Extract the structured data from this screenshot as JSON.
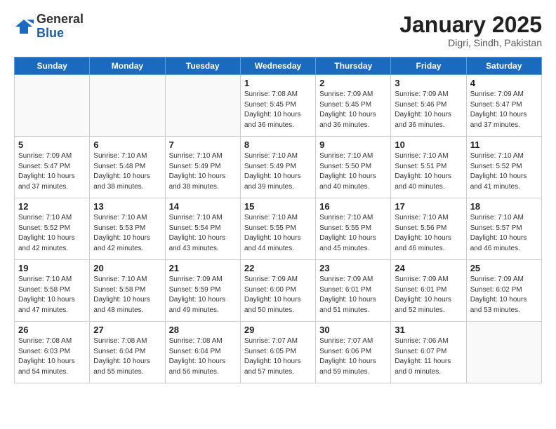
{
  "header": {
    "logo_general": "General",
    "logo_blue": "Blue",
    "title": "January 2025",
    "subtitle": "Digri, Sindh, Pakistan"
  },
  "days_of_week": [
    "Sunday",
    "Monday",
    "Tuesday",
    "Wednesday",
    "Thursday",
    "Friday",
    "Saturday"
  ],
  "weeks": [
    [
      {
        "num": "",
        "info": ""
      },
      {
        "num": "",
        "info": ""
      },
      {
        "num": "",
        "info": ""
      },
      {
        "num": "1",
        "info": "Sunrise: 7:08 AM\nSunset: 5:45 PM\nDaylight: 10 hours\nand 36 minutes."
      },
      {
        "num": "2",
        "info": "Sunrise: 7:09 AM\nSunset: 5:45 PM\nDaylight: 10 hours\nand 36 minutes."
      },
      {
        "num": "3",
        "info": "Sunrise: 7:09 AM\nSunset: 5:46 PM\nDaylight: 10 hours\nand 36 minutes."
      },
      {
        "num": "4",
        "info": "Sunrise: 7:09 AM\nSunset: 5:47 PM\nDaylight: 10 hours\nand 37 minutes."
      }
    ],
    [
      {
        "num": "5",
        "info": "Sunrise: 7:09 AM\nSunset: 5:47 PM\nDaylight: 10 hours\nand 37 minutes."
      },
      {
        "num": "6",
        "info": "Sunrise: 7:10 AM\nSunset: 5:48 PM\nDaylight: 10 hours\nand 38 minutes."
      },
      {
        "num": "7",
        "info": "Sunrise: 7:10 AM\nSunset: 5:49 PM\nDaylight: 10 hours\nand 38 minutes."
      },
      {
        "num": "8",
        "info": "Sunrise: 7:10 AM\nSunset: 5:49 PM\nDaylight: 10 hours\nand 39 minutes."
      },
      {
        "num": "9",
        "info": "Sunrise: 7:10 AM\nSunset: 5:50 PM\nDaylight: 10 hours\nand 40 minutes."
      },
      {
        "num": "10",
        "info": "Sunrise: 7:10 AM\nSunset: 5:51 PM\nDaylight: 10 hours\nand 40 minutes."
      },
      {
        "num": "11",
        "info": "Sunrise: 7:10 AM\nSunset: 5:52 PM\nDaylight: 10 hours\nand 41 minutes."
      }
    ],
    [
      {
        "num": "12",
        "info": "Sunrise: 7:10 AM\nSunset: 5:52 PM\nDaylight: 10 hours\nand 42 minutes."
      },
      {
        "num": "13",
        "info": "Sunrise: 7:10 AM\nSunset: 5:53 PM\nDaylight: 10 hours\nand 42 minutes."
      },
      {
        "num": "14",
        "info": "Sunrise: 7:10 AM\nSunset: 5:54 PM\nDaylight: 10 hours\nand 43 minutes."
      },
      {
        "num": "15",
        "info": "Sunrise: 7:10 AM\nSunset: 5:55 PM\nDaylight: 10 hours\nand 44 minutes."
      },
      {
        "num": "16",
        "info": "Sunrise: 7:10 AM\nSunset: 5:55 PM\nDaylight: 10 hours\nand 45 minutes."
      },
      {
        "num": "17",
        "info": "Sunrise: 7:10 AM\nSunset: 5:56 PM\nDaylight: 10 hours\nand 46 minutes."
      },
      {
        "num": "18",
        "info": "Sunrise: 7:10 AM\nSunset: 5:57 PM\nDaylight: 10 hours\nand 46 minutes."
      }
    ],
    [
      {
        "num": "19",
        "info": "Sunrise: 7:10 AM\nSunset: 5:58 PM\nDaylight: 10 hours\nand 47 minutes."
      },
      {
        "num": "20",
        "info": "Sunrise: 7:10 AM\nSunset: 5:58 PM\nDaylight: 10 hours\nand 48 minutes."
      },
      {
        "num": "21",
        "info": "Sunrise: 7:09 AM\nSunset: 5:59 PM\nDaylight: 10 hours\nand 49 minutes."
      },
      {
        "num": "22",
        "info": "Sunrise: 7:09 AM\nSunset: 6:00 PM\nDaylight: 10 hours\nand 50 minutes."
      },
      {
        "num": "23",
        "info": "Sunrise: 7:09 AM\nSunset: 6:01 PM\nDaylight: 10 hours\nand 51 minutes."
      },
      {
        "num": "24",
        "info": "Sunrise: 7:09 AM\nSunset: 6:01 PM\nDaylight: 10 hours\nand 52 minutes."
      },
      {
        "num": "25",
        "info": "Sunrise: 7:09 AM\nSunset: 6:02 PM\nDaylight: 10 hours\nand 53 minutes."
      }
    ],
    [
      {
        "num": "26",
        "info": "Sunrise: 7:08 AM\nSunset: 6:03 PM\nDaylight: 10 hours\nand 54 minutes."
      },
      {
        "num": "27",
        "info": "Sunrise: 7:08 AM\nSunset: 6:04 PM\nDaylight: 10 hours\nand 55 minutes."
      },
      {
        "num": "28",
        "info": "Sunrise: 7:08 AM\nSunset: 6:04 PM\nDaylight: 10 hours\nand 56 minutes."
      },
      {
        "num": "29",
        "info": "Sunrise: 7:07 AM\nSunset: 6:05 PM\nDaylight: 10 hours\nand 57 minutes."
      },
      {
        "num": "30",
        "info": "Sunrise: 7:07 AM\nSunset: 6:06 PM\nDaylight: 10 hours\nand 59 minutes."
      },
      {
        "num": "31",
        "info": "Sunrise: 7:06 AM\nSunset: 6:07 PM\nDaylight: 11 hours\nand 0 minutes."
      },
      {
        "num": "",
        "info": ""
      }
    ]
  ]
}
